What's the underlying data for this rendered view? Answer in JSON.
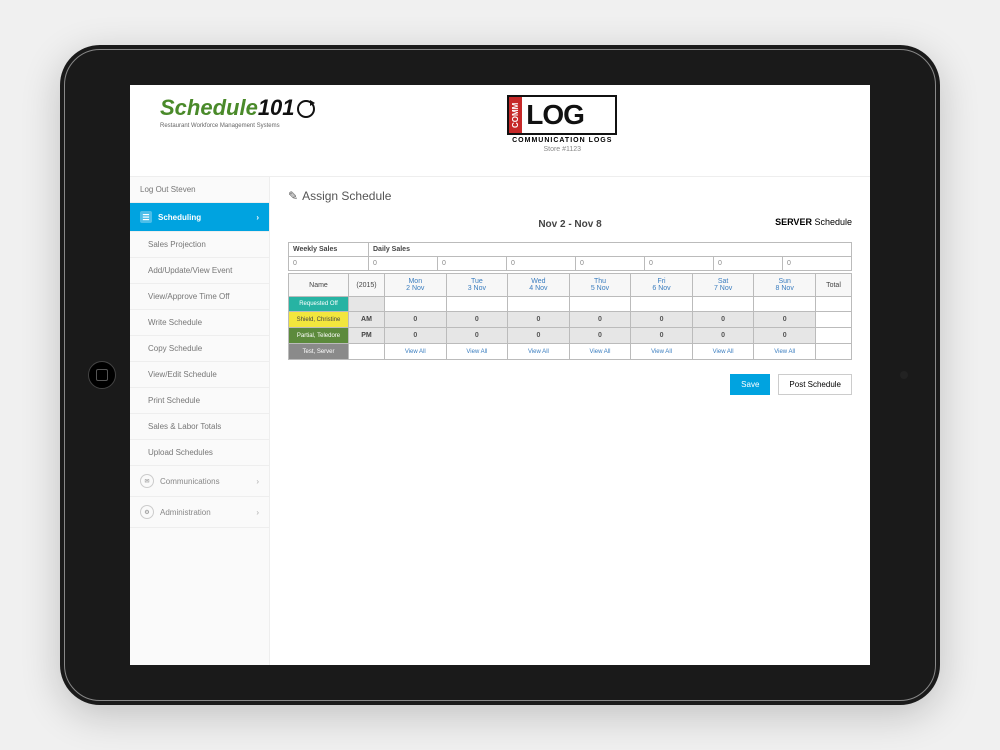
{
  "logos": {
    "left_brand_text": "Schedule",
    "left_brand_num": "101",
    "left_tagline": "Restaurant Workforce Management Systems",
    "comm_vertical": "COMM",
    "comm_log": "LOG",
    "comm_sub": "COMMUNICATION LOGS",
    "store": "Store #1123"
  },
  "sidebar": {
    "logout": "Log Out Steven",
    "scheduling": "Scheduling",
    "items": [
      "Sales Projection",
      "Add/Update/View Event",
      "View/Approve Time Off",
      "Write Schedule",
      "Copy Schedule",
      "View/Edit Schedule",
      "Print Schedule",
      "Sales & Labor Totals",
      "Upload Schedules"
    ],
    "communications": "Communications",
    "administration": "Administration"
  },
  "page": {
    "title": "Assign Schedule",
    "date_range": "Nov 2 - Nov 8",
    "server_label_bold": "SERVER",
    "server_label_rest": "Schedule"
  },
  "sales": {
    "weekly_header": "Weekly Sales",
    "daily_header": "Daily Sales",
    "weekly_val": "0",
    "daily_vals": [
      "0",
      "0",
      "0",
      "0",
      "0",
      "0",
      "0"
    ]
  },
  "schedule": {
    "name_header": "Name",
    "year_header": "(2015)",
    "total_header": "Total",
    "days": [
      {
        "dow": "Mon",
        "date": "2 Nov"
      },
      {
        "dow": "Tue",
        "date": "3 Nov"
      },
      {
        "dow": "Wed",
        "date": "4 Nov"
      },
      {
        "dow": "Thu",
        "date": "5 Nov"
      },
      {
        "dow": "Fri",
        "date": "6 Nov"
      },
      {
        "dow": "Sat",
        "date": "7 Nov"
      },
      {
        "dow": "Sun",
        "date": "8 Nov"
      }
    ],
    "rows": [
      {
        "name": "Requested Off",
        "shift": "",
        "vals": [
          "",
          "",
          "",
          "",
          "",
          "",
          ""
        ]
      },
      {
        "name": "Shield, Christine",
        "shift": "AM",
        "vals": [
          "0",
          "0",
          "0",
          "0",
          "0",
          "0",
          "0"
        ]
      },
      {
        "name": "Partial, Teledore",
        "shift": "PM",
        "vals": [
          "0",
          "0",
          "0",
          "0",
          "0",
          "0",
          "0"
        ]
      },
      {
        "name": "Test, Server",
        "shift": "",
        "vals": [
          "View All",
          "View All",
          "View All",
          "View All",
          "View All",
          "View All",
          "View All"
        ]
      }
    ]
  },
  "actions": {
    "save": "Save",
    "post": "Post Schedule"
  }
}
